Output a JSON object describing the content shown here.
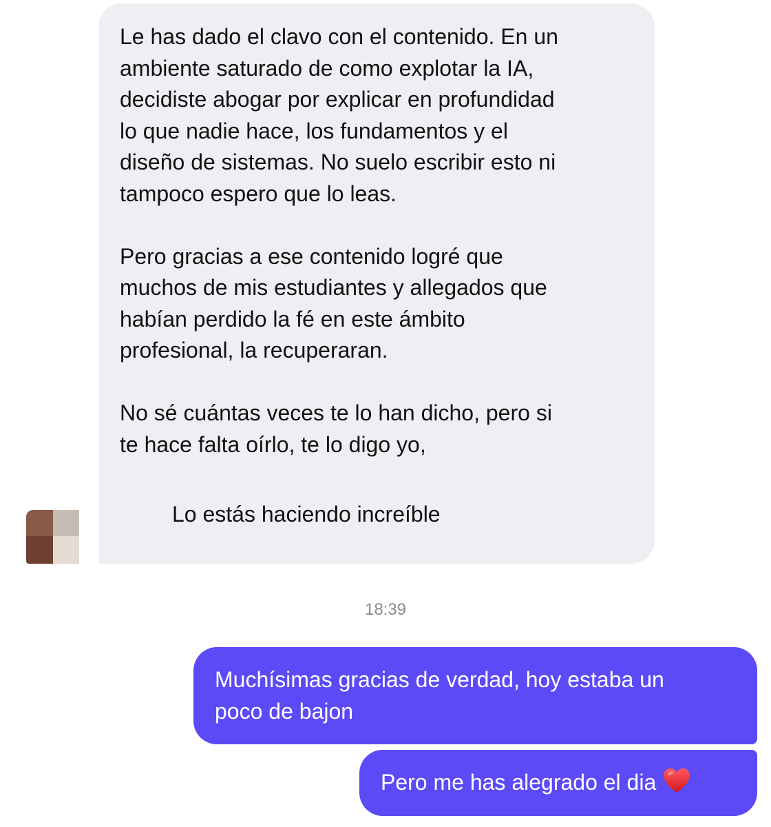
{
  "conversation": {
    "incoming": {
      "paragraphs": [
        "Le has dado el clavo con el contenido. En un\nambiente saturado de como explotar la IA,\ndecidiste abogar por explicar en profundidad\nlo que nadie hace, los fundamentos y el\ndiseño de sistemas. No suelo escribir esto ni\ntampoco espero que lo leas.",
        "Pero gracias a ese contenido logré que\nmuchos de mis estudiantes y allegados que\nhabían perdido la fé en este ámbito\nprofesional, la recuperaran.",
        "No sé cuántas veces te lo han dicho, pero si\nte hace falta oírlo, te lo digo yo,"
      ],
      "closing_line": "Lo estás haciendo increíble",
      "avatar_icon": "blurred-avatar"
    },
    "timestamp": "18:39",
    "outgoing": [
      {
        "text": "Muchísimas gracias de verdad, hoy estaba un\npoco de bajon"
      },
      {
        "text": "Pero me has alegrado el dia",
        "emoji": "heart-icon"
      }
    ]
  },
  "colors": {
    "incoming_bubble": "#eeeff3",
    "outgoing_bubble": "#5b4af5",
    "timestamp": "#8a8a8e",
    "heart": "#e0242b"
  }
}
